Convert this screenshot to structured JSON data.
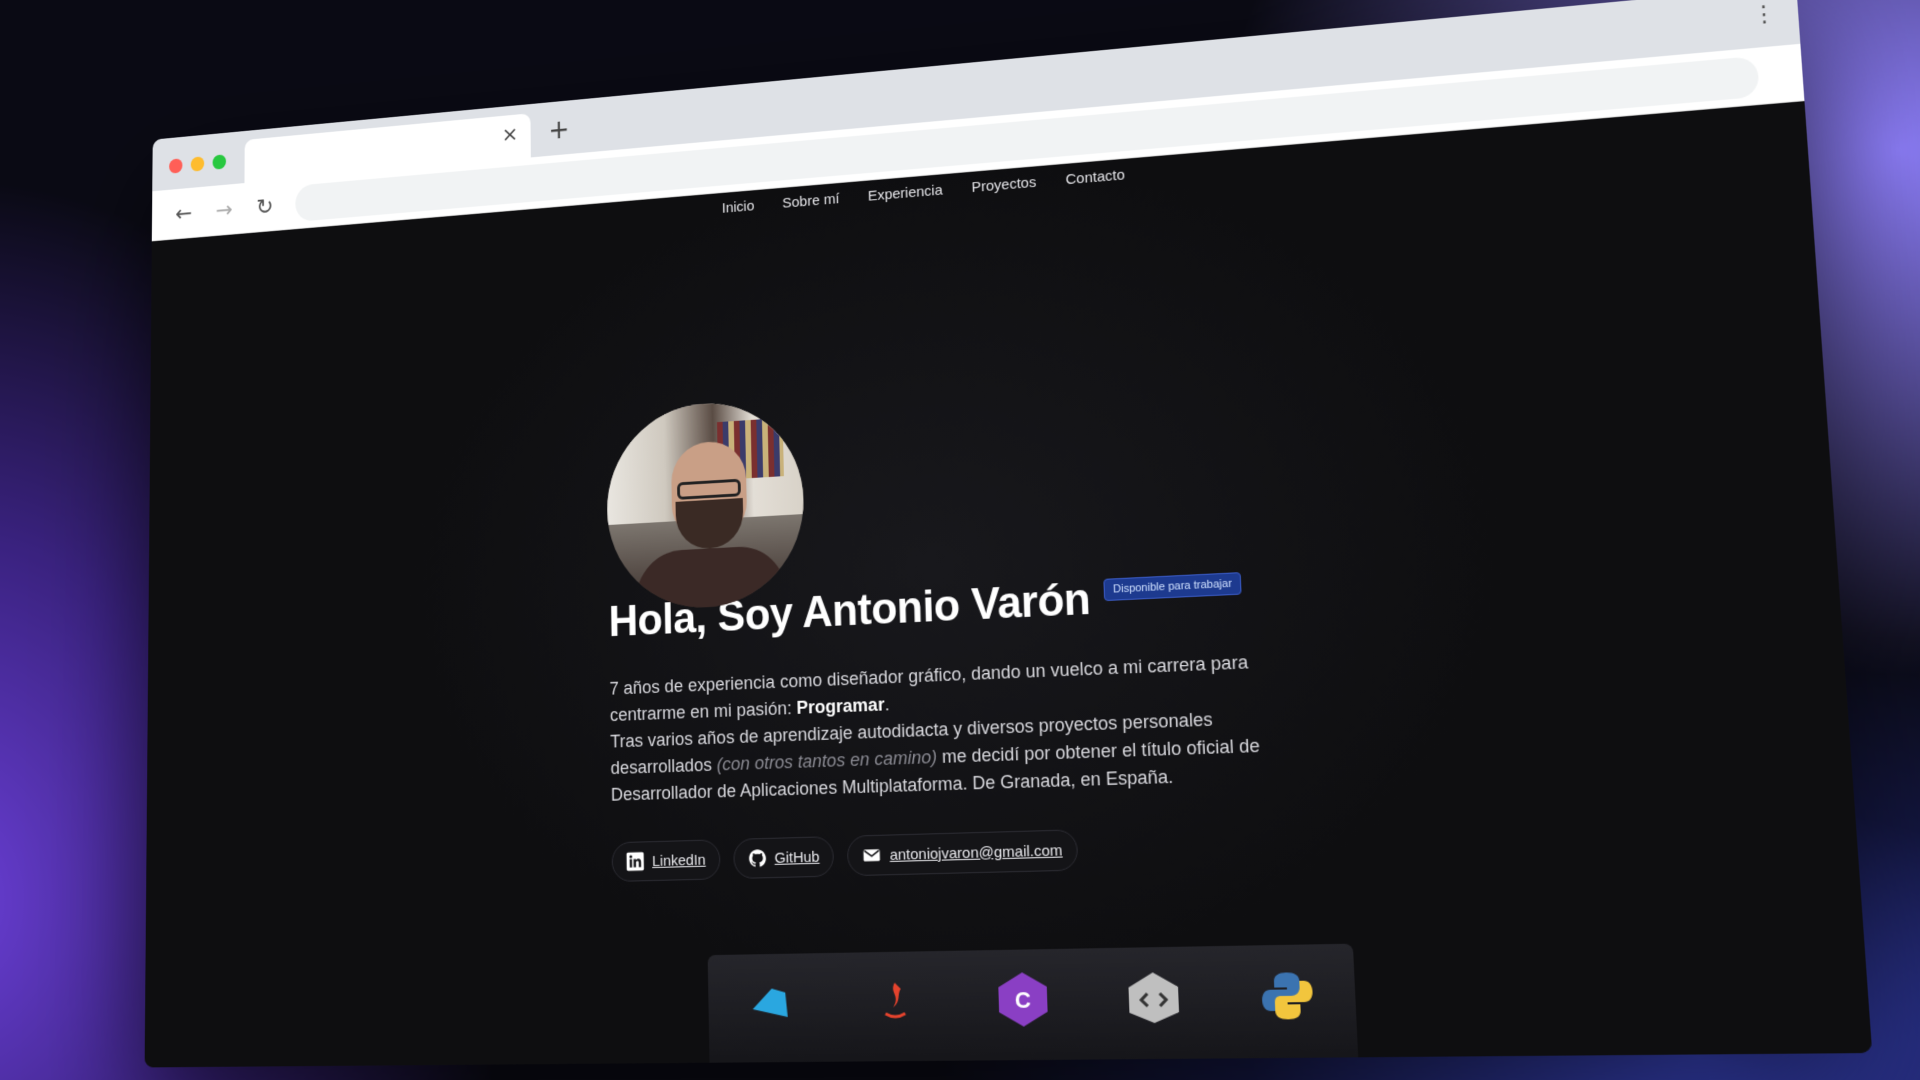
{
  "browser": {
    "tab_close": "×",
    "new_tab": "+",
    "menu": "⋮",
    "back": "←",
    "forward": "→",
    "reload": "↻"
  },
  "nav": {
    "items": [
      "Inicio",
      "Sobre mí",
      "Experiencia",
      "Proyectos",
      "Contacto"
    ]
  },
  "hero": {
    "greeting": "Hola, Soy Antonio Varón",
    "badge": "Disponible para trabajar",
    "bio_line1": "7 años de experiencia como diseñador gráfico, dando un vuelco a mi carrera para centrarme en mi pasión: ",
    "bio_strong": "Programar",
    "bio_line1_end": ".",
    "bio_line2": "Tras varios años de aprendizaje autodidacta y diversos proyectos personales desarrollados ",
    "bio_em": "(con otros tantos en camino)",
    "bio_line2_end": " me decidí por obtener el título oficial de Desarrollador de Aplicaciones Multiplataforma. ",
    "bio_line3": "De Granada, en España."
  },
  "links": {
    "linkedin": "LinkedIn",
    "github": "GitHub",
    "email": "antoniojvaron@gmail.com"
  },
  "tech_icons": [
    "dart-icon",
    "java-icon",
    "csharp-icon",
    "coder-icon",
    "python-icon"
  ],
  "colors": {
    "badge_bg": "#1d3a8f",
    "page_bg": "#0e0e10"
  }
}
